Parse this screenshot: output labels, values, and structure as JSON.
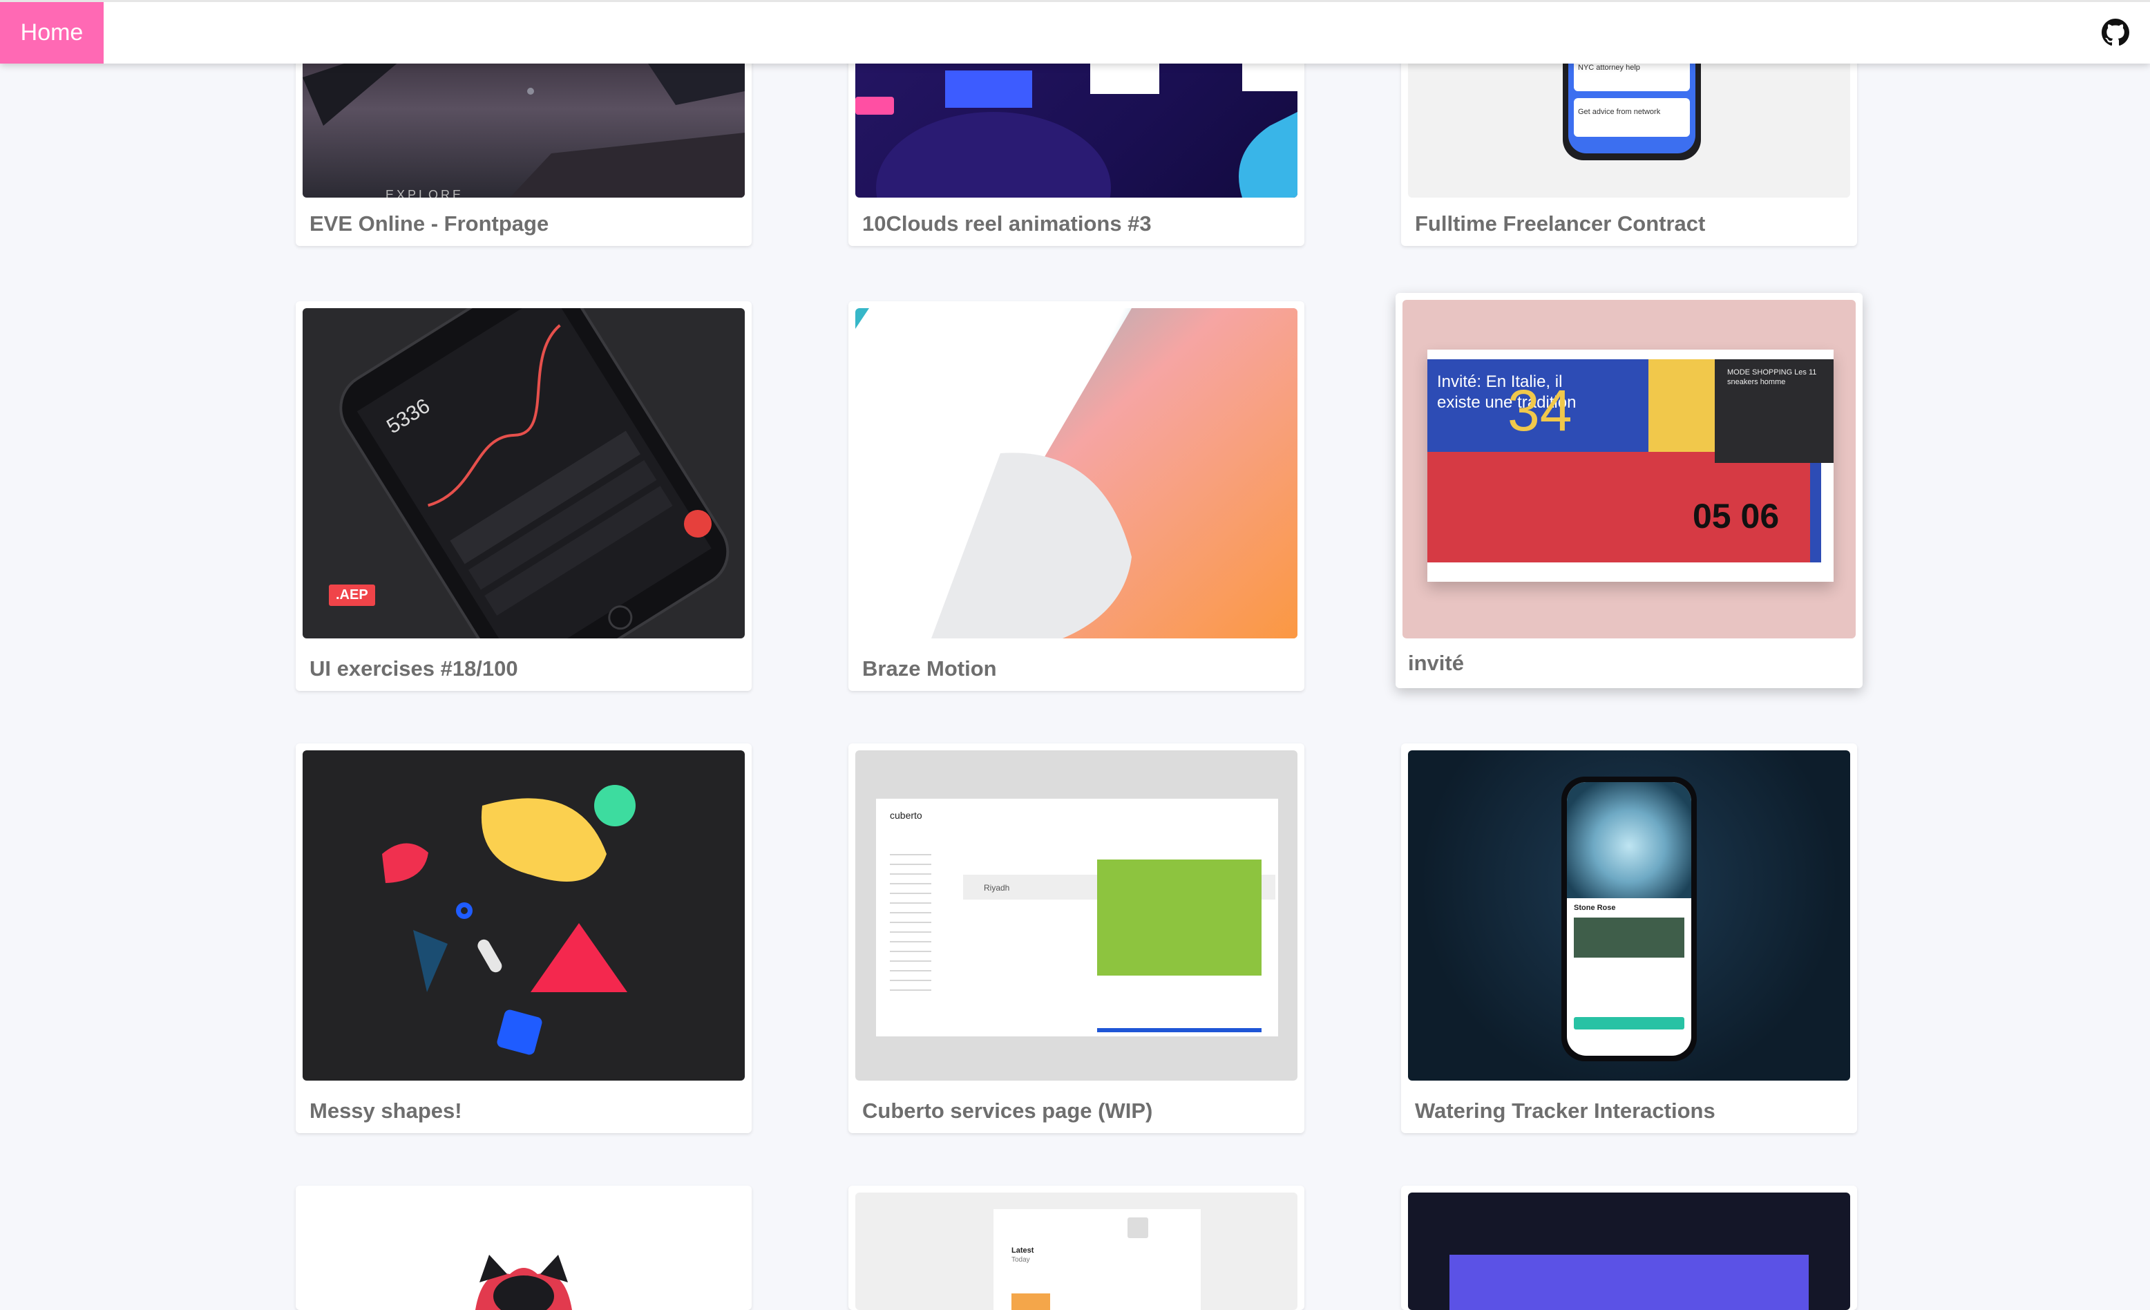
{
  "header": {
    "home_label": "Home",
    "github_icon": "github-icon",
    "accent": "#ff69b4"
  },
  "projects": [
    {
      "title": "EVE Online - Frontpage"
    },
    {
      "title": "10Clouds reel animations #3"
    },
    {
      "title": "Fulltime Freelancer Contract"
    },
    {
      "title": "UI exercises #18/100"
    },
    {
      "title": "Braze Motion"
    },
    {
      "title": "invité"
    },
    {
      "title": "Messy shapes!"
    },
    {
      "title": "Cuberto services page (WIP)"
    },
    {
      "title": "Watering Tracker Interactions"
    }
  ],
  "thumb_text": {
    "eve": "EXPLORE",
    "fulltime_1": "NYC attorney help",
    "fulltime_2": "Get advice from network",
    "ui18_value": "5336",
    "ui18_badge": ".AEP",
    "invite_headline": "Invité: En Italie, il existe une tradition",
    "invite_number": "34",
    "invite_shop": "MODE SHOPPING Les 11 sneakers homme",
    "invite_date": "05 06",
    "cuberto_logo": "cuberto",
    "cuberto_item": "Riyadh",
    "water_plant": "Stone Rose",
    "bottom_latest": "Latest",
    "bottom_today": "Today"
  }
}
